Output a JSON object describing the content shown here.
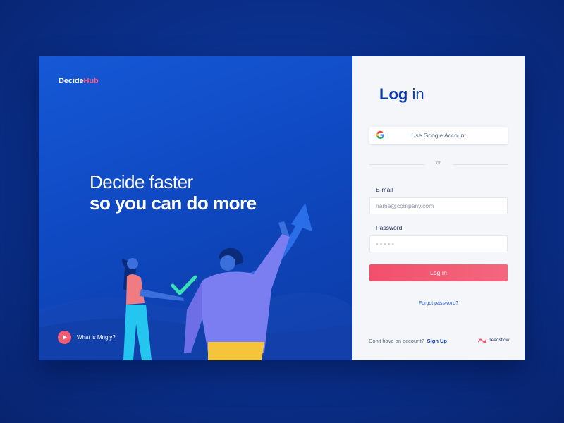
{
  "brand": {
    "name_part1": "Decide",
    "name_part2": "Hub",
    "accent_color": "#ff5a7a"
  },
  "hero": {
    "headline_line1": "Decide faster",
    "headline_line2": "so you can do more",
    "what_is_label": "What is Mngly?",
    "play_icon": "play-icon"
  },
  "login": {
    "title_part1": "Log",
    "title_part2": " in",
    "google_button_label": "Use Google Account",
    "google_icon": "google-icon",
    "divider_text": "or",
    "email_label": "E-mail",
    "email_placeholder": "name@company.com",
    "password_label": "Password",
    "password_mask": "●●●●●",
    "submit_label": "Log In",
    "forgot_label": "Forgot password?",
    "no_account_text": "Don't have an account?",
    "signup_label": "Sign Up",
    "footer_logo_text": "needsflow"
  },
  "colors": {
    "primary_blue": "#0b3aa8",
    "button_pink": "#f34f6c",
    "panel_bg": "#f4f6fa"
  }
}
